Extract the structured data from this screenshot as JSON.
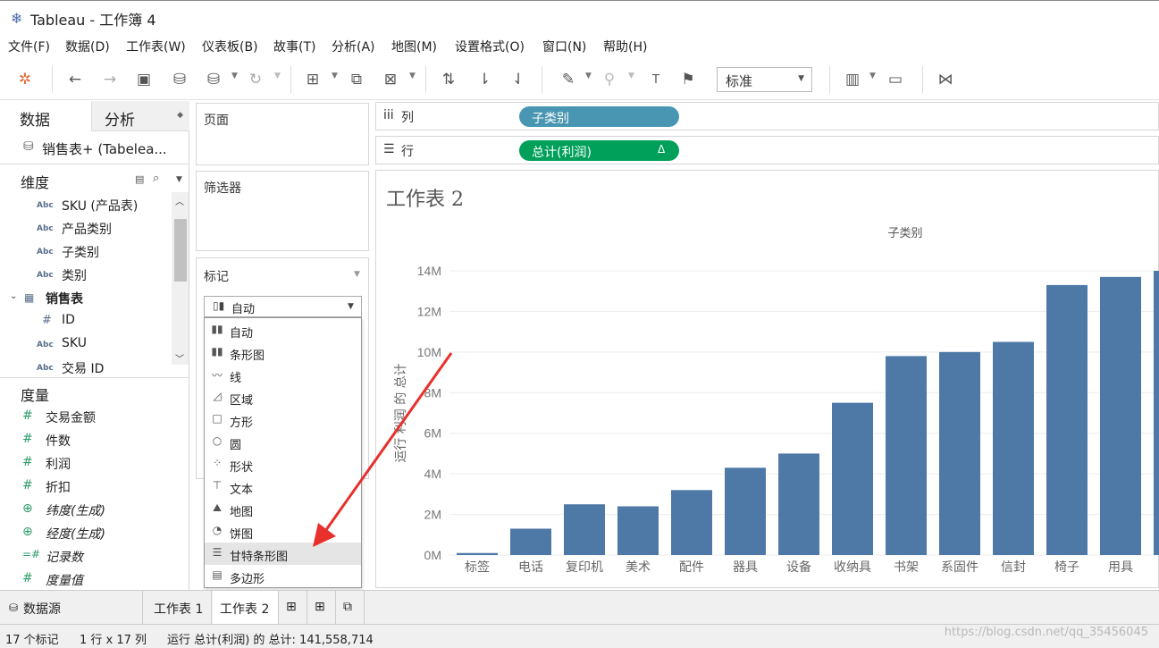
{
  "window": {
    "title": "Tableau - 工作簿 4"
  },
  "menu": [
    "文件(F)",
    "数据(D)",
    "工作表(W)",
    "仪表板(B)",
    "故事(T)",
    "分析(A)",
    "地图(M)",
    "设置格式(O)",
    "窗口(N)",
    "帮助(H)"
  ],
  "toolbar": {
    "fit_value": "标准"
  },
  "data_pane": {
    "tabs": [
      "数据",
      "分析"
    ],
    "datasource": "销售表+ (Tabelea...",
    "dimensions_header": "维度",
    "dimensions": [
      {
        "type": "Abc",
        "name": "SKU (产品表)"
      },
      {
        "type": "Abc",
        "name": "产品类别"
      },
      {
        "type": "Abc",
        "name": "子类别"
      },
      {
        "type": "Abc",
        "name": "类别"
      },
      {
        "type": "table",
        "name": "销售表"
      },
      {
        "type": "#",
        "name": "ID"
      },
      {
        "type": "Abc",
        "name": "SKU"
      },
      {
        "type": "Abc",
        "name": "交易 ID"
      }
    ],
    "measures_header": "度量",
    "measures": [
      {
        "type": "#",
        "name": "交易金额"
      },
      {
        "type": "#",
        "name": "件数"
      },
      {
        "type": "#",
        "name": "利润"
      },
      {
        "type": "#",
        "name": "折扣"
      },
      {
        "type": "globe",
        "name": "纬度(生成)"
      },
      {
        "type": "globe",
        "name": "经度(生成)"
      },
      {
        "type": "=#",
        "name": "记录数"
      },
      {
        "type": "#",
        "name": "度量值"
      }
    ]
  },
  "shelves": {
    "pages": "页面",
    "filters": "筛选器",
    "marks": "标记",
    "columns_label": "列",
    "rows_label": "行"
  },
  "marks": {
    "selected": "自动",
    "options": [
      "自动",
      "条形图",
      "线",
      "区域",
      "方形",
      "圆",
      "形状",
      "文本",
      "地图",
      "饼图",
      "甘特条形图",
      "多边形"
    ],
    "highlighted": "甘特条形图"
  },
  "pills": {
    "columns": "子类别",
    "rows": "总计(利润)",
    "rows_delta": "Δ"
  },
  "colors": {
    "bar": "#4e79a7",
    "pill_dim": "#4996b2",
    "pill_meas": "#00a05a",
    "arrow": "#e8302c"
  },
  "view": {
    "sheet_title": "工作表 2"
  },
  "chart_data": {
    "type": "bar",
    "title": "工作表 2",
    "header": "子类别",
    "ylabel": "运行 利润 的 总计",
    "ytick_labels": [
      "0M",
      "2M",
      "4M",
      "6M",
      "8M",
      "10M",
      "12M",
      "14M"
    ],
    "ylim": [
      0,
      14
    ],
    "yunit": "M",
    "grid": true,
    "categories": [
      "标签",
      "电话",
      "复印机",
      "美术",
      "配件",
      "器具",
      "设备",
      "收纳具",
      "书架",
      "系固件",
      "信封",
      "椅子",
      "用具"
    ],
    "values": [
      0.1,
      1.3,
      2.5,
      2.4,
      3.2,
      4.3,
      5.0,
      7.5,
      9.8,
      10.0,
      10.5,
      13.3,
      13.7,
      14.0
    ]
  },
  "bottom_tabs": [
    "数据源",
    "工作表 1",
    "工作表 2"
  ],
  "status": {
    "marks": "17 个标记",
    "dims": "1 行 x 17 列",
    "sum": "运行 总计(利润) 的 总计: 141,558,714"
  },
  "watermark": "https://blog.csdn.net/qq_35456045"
}
